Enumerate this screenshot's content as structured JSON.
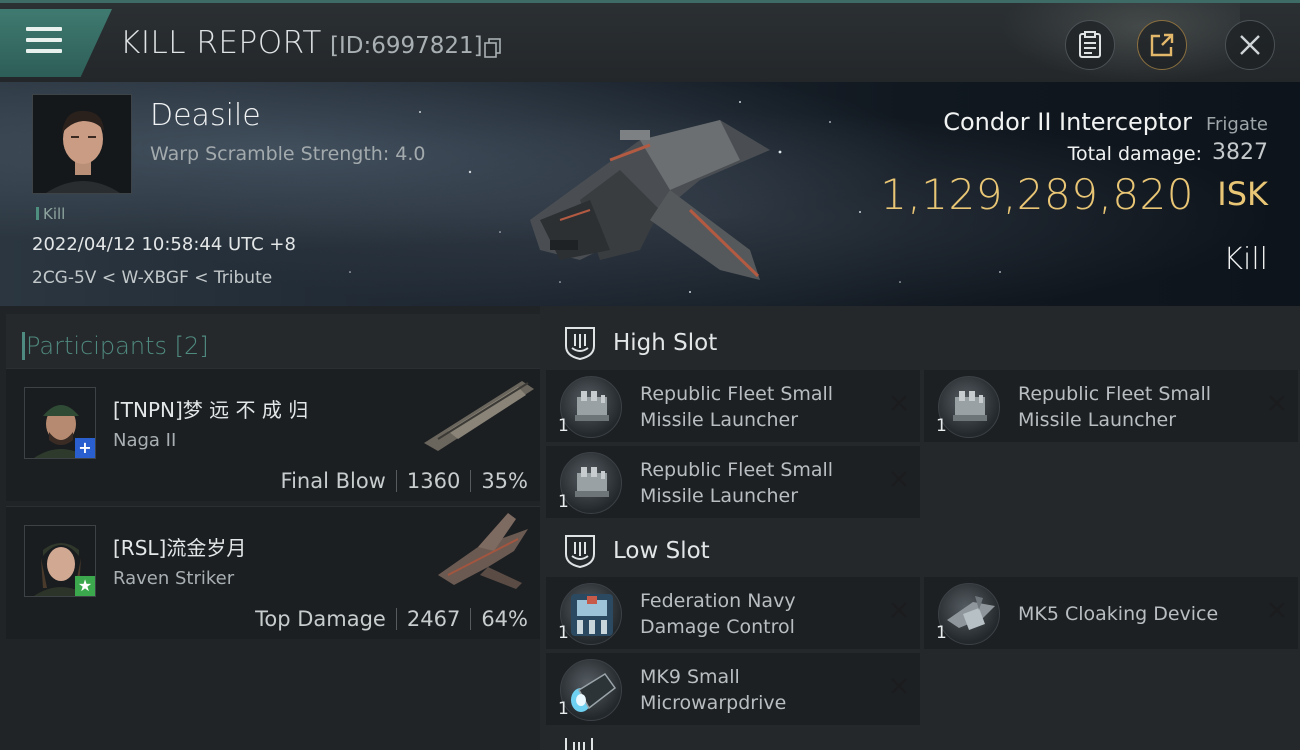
{
  "header": {
    "title": "KILL REPORT",
    "report_id": "[ID:6997821]"
  },
  "victim": {
    "name": "Deasile",
    "warp_scramble": "Warp Scramble Strength: 4.0",
    "tag": "Kill",
    "timestamp": "2022/04/12 10:58:44 UTC +8",
    "location": "2CG-5V < W-XBGF < Tribute"
  },
  "ship": {
    "name": "Condor II Interceptor",
    "class": "Frigate",
    "total_damage_label": "Total damage:",
    "total_damage": "3827",
    "isk_value": "1,129,289,820",
    "isk_unit": "ISK",
    "result": "Kill"
  },
  "participants": {
    "title": "Participants [2]",
    "items": [
      {
        "name": "[TNPN]梦 远 不 成 归",
        "ship": "Naga II",
        "role": "Final Blow",
        "damage": "1360",
        "percent": "35%",
        "badge": "+",
        "badge_color": "#2a5fd0"
      },
      {
        "name": "[RSL]流金岁月",
        "ship": "Raven Striker",
        "role": "Top Damage",
        "damage": "2467",
        "percent": "64%",
        "badge": "★",
        "badge_color": "#3ca84d"
      }
    ]
  },
  "fitting": {
    "high_slot": {
      "title": "High Slot",
      "modules": [
        {
          "line1": "Republic Fleet Small",
          "line2": "Missile Launcher",
          "qty": "1"
        },
        {
          "line1": "Republic Fleet Small",
          "line2": "Missile Launcher",
          "qty": "1"
        },
        {
          "line1": "Republic Fleet Small",
          "line2": "Missile Launcher",
          "qty": "1"
        }
      ]
    },
    "low_slot": {
      "title": "Low Slot",
      "modules": [
        {
          "line1": "Federation Navy",
          "line2": "Damage Control",
          "qty": "1"
        },
        {
          "line1": "MK5 Cloaking Device",
          "line2": "",
          "qty": "1"
        },
        {
          "line1": "MK9 Small",
          "line2": "Microwarpdrive",
          "qty": "1"
        }
      ]
    }
  },
  "colors": {
    "accent_teal": "#4f8a80",
    "isk_gold": "#e9c675"
  }
}
